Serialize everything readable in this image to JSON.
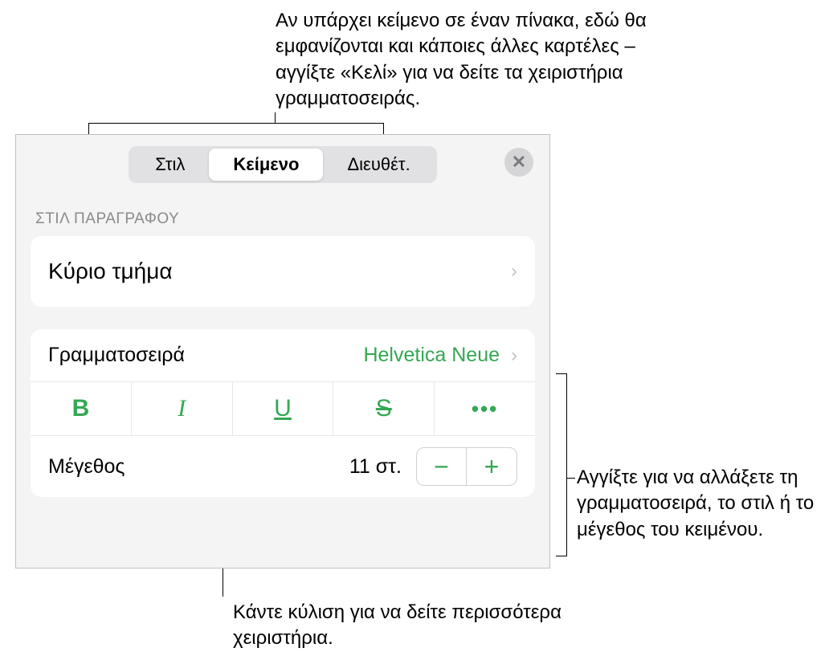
{
  "callouts": {
    "top": "Αν υπάρχει κείμενο σε έναν πίνακα, εδώ θα εμφανίζονται και κάποιες άλλες καρτέλες – αγγίξτε «Κελί» για να δείτε τα χειριστήρια γραμματοσειράς.",
    "right": "Αγγίξτε για να αλλάξετε τη γραμματοσειρά, το στιλ ή το μέγεθος του κειμένου.",
    "bottom": "Κάντε κύλιση για να δείτε περισσότερα χειριστήρια."
  },
  "tabs": {
    "style": "Στιλ",
    "text": "Κείμενο",
    "arrange": "Διευθέτ."
  },
  "paragraph_style": {
    "section_label": "ΣΤΙΛ ΠΑΡΑΓΡΑΦΟΥ",
    "value": "Κύριο τμήμα"
  },
  "font": {
    "label": "Γραμματοσειρά",
    "value": "Helvetica Neue"
  },
  "style_buttons": {
    "bold": "B",
    "italic": "I",
    "underline": "U",
    "strike": "S",
    "more": "•••"
  },
  "size": {
    "label": "Μέγεθος",
    "value": "11 στ.",
    "minus": "−",
    "plus": "+"
  },
  "icons": {
    "close": "✕",
    "chevron": "›"
  }
}
